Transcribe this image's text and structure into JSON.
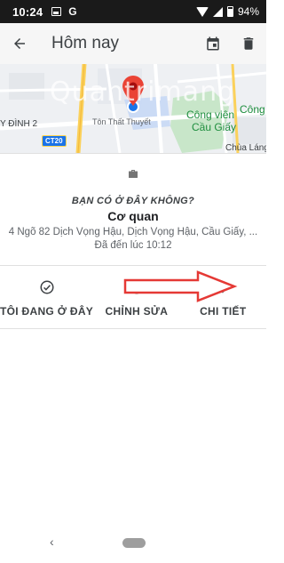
{
  "status_bar": {
    "time": "10:24",
    "battery": "94%"
  },
  "app_bar": {
    "title": "Hôm nay"
  },
  "map": {
    "labels": {
      "district": "Y ĐÌNH 2",
      "road": "Tôn Thất Thuyết",
      "park_line1": "Công viên",
      "park_line2": "Cầu Giấy",
      "edge_label_top": "Công",
      "edge_label_bottom": "Chùa Láng"
    },
    "road_badge": "CT20",
    "watermark": "Quantrimang"
  },
  "visit": {
    "question": "BẠN CÓ Ở ĐÂY KHÔNG?",
    "place_name": "Cơ quan",
    "address": "4 Ngõ 82 Dịch Vọng Hậu, Dịch Vọng Hậu, Cầu Giấy, ...",
    "arrived": "Đã đến lúc 10:12"
  },
  "actions": [
    {
      "label": "TÔI ĐANG Ở ĐÂY",
      "icon": "check-circle-icon"
    },
    {
      "label": "CHỈNH SỬA",
      "icon": "edit-circle-icon"
    },
    {
      "label": "CHI TIẾT",
      "icon": "location-pin-icon"
    }
  ],
  "colors": {
    "accent_blue": "#1a73e8",
    "marker_red": "#ea4335",
    "annotation_red": "#e53935",
    "park_green": "#1e8e3e"
  }
}
